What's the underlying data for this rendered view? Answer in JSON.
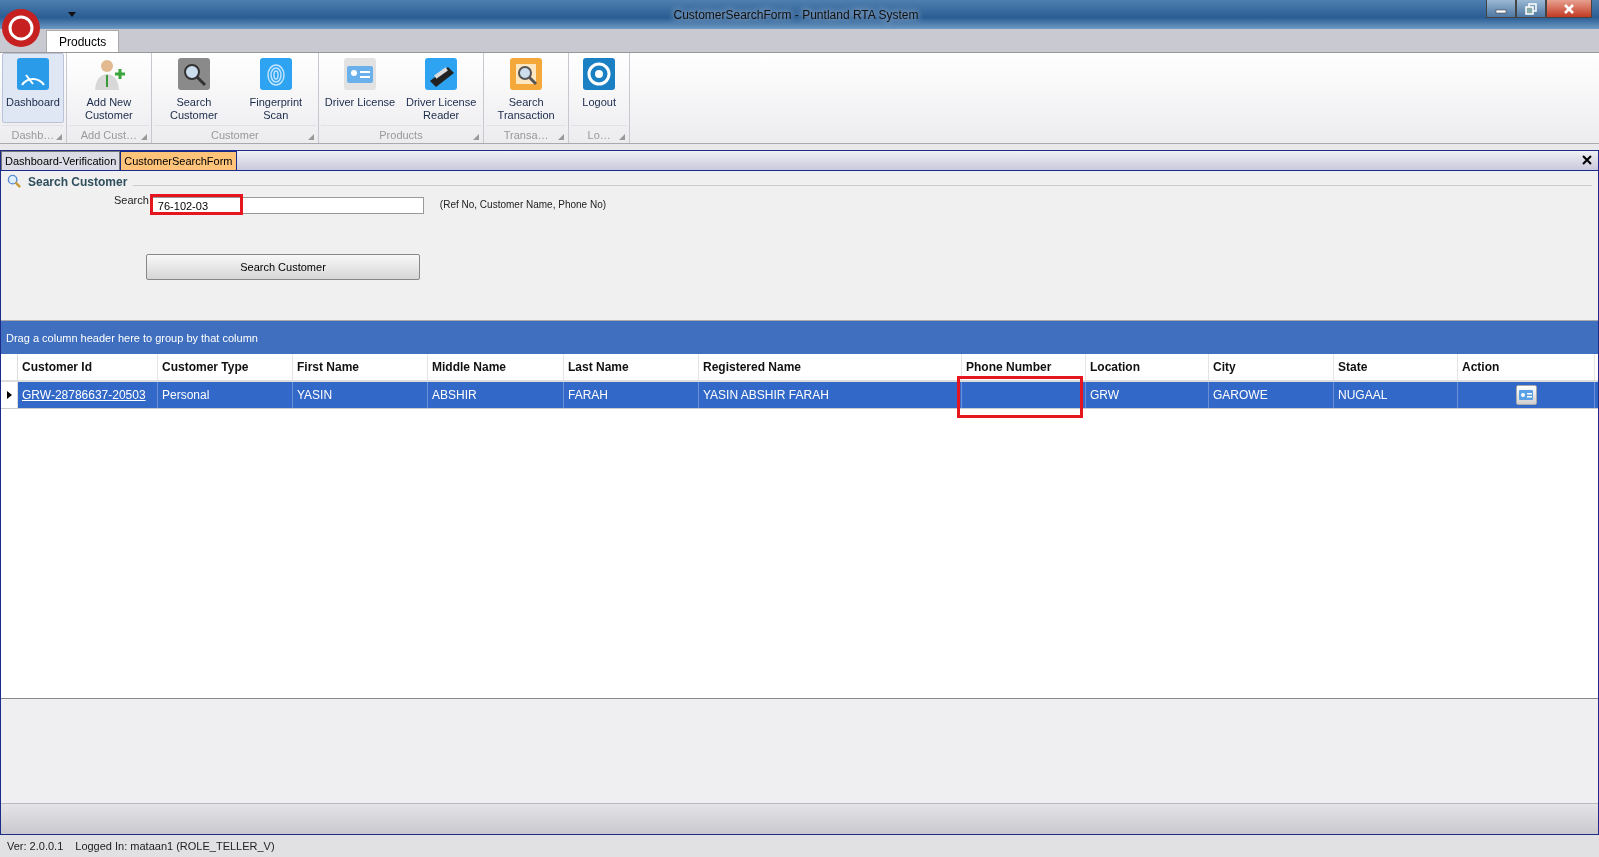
{
  "window": {
    "title": "CustomerSearchForm - Puntland RTA System"
  },
  "ribbon": {
    "tabs": [
      {
        "label": "Products",
        "selected": true
      }
    ],
    "groups": [
      {
        "label": "Dashb…",
        "items": [
          {
            "label": "Dashboard",
            "kind": "dashboard",
            "selected": true
          }
        ]
      },
      {
        "label": "Add Cust…",
        "items": [
          {
            "label": "Add New Customer",
            "kind": "add-user",
            "selected": false
          }
        ]
      },
      {
        "label": "Customer",
        "items": [
          {
            "label": "Search Customer",
            "kind": "search-user",
            "selected": false
          },
          {
            "label": "Fingerprint Scan",
            "kind": "fingerprint",
            "selected": false
          }
        ]
      },
      {
        "label": "Products",
        "items": [
          {
            "label": "Driver License",
            "kind": "license",
            "selected": false
          },
          {
            "label": "Driver License Reader",
            "kind": "reader",
            "selected": false
          }
        ]
      },
      {
        "label": "Transa…",
        "items": [
          {
            "label": "Search Transaction",
            "kind": "transaction",
            "selected": false
          }
        ]
      },
      {
        "label": "Lo…",
        "items": [
          {
            "label": "Logout",
            "kind": "logout",
            "selected": false
          }
        ]
      }
    ]
  },
  "document_tabs": [
    {
      "label": "Dashboard-Verification",
      "selected": false
    },
    {
      "label": "CustomerSearchForm",
      "selected": true
    }
  ],
  "search_panel": {
    "title": "Search Customer",
    "field_label": "Search",
    "value": "76-102-03",
    "highlighted": true,
    "hint": "(Ref No, Customer Name, Phone No)",
    "button": "Search Customer"
  },
  "grid": {
    "group_panel": "Drag a column header here to group by that column",
    "columns": [
      {
        "label": "Customer Id",
        "highlighted": false
      },
      {
        "label": "Customer Type",
        "highlighted": false
      },
      {
        "label": "First Name",
        "highlighted": false
      },
      {
        "label": "Middle Name",
        "highlighted": false
      },
      {
        "label": "Last Name",
        "highlighted": false
      },
      {
        "label": "Registered Name",
        "highlighted": false
      },
      {
        "label": "Phone Number",
        "highlighted": true
      },
      {
        "label": "Location",
        "highlighted": false
      },
      {
        "label": "City",
        "highlighted": false
      },
      {
        "label": "State",
        "highlighted": false
      },
      {
        "label": "Action",
        "highlighted": false
      }
    ],
    "rows": [
      {
        "selected": true,
        "cells": [
          "GRW-28786637-20503",
          "Personal",
          "YASIN",
          "ABSHIR",
          "FARAH",
          "YASIN ABSHIR FARAH",
          "",
          "GRW",
          "GAROWE",
          "NUGAAL"
        ]
      }
    ]
  },
  "status_bar": [
    "Ver: 2.0.0.1",
    "Logged In: mataan1 (ROLE_TELLER_V)"
  ]
}
